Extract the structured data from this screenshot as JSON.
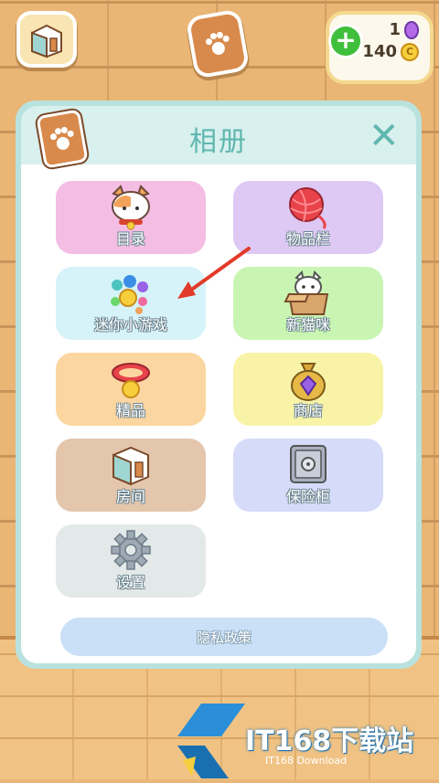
{
  "currency": {
    "gems": "1",
    "coins": "140",
    "coin_symbol": "C",
    "add_symbol": "+"
  },
  "dialog": {
    "title": "相册",
    "close_symbol": "✕",
    "tiles": [
      {
        "label": "目录",
        "color": "#f4bde3"
      },
      {
        "label": "物品栏",
        "color": "#dec8f4"
      },
      {
        "label": "迷你小游戏",
        "color": "#d6f3f9"
      },
      {
        "label": "新猫咪",
        "color": "#c9f5b3"
      },
      {
        "label": "精品",
        "color": "#fcd6a0"
      },
      {
        "label": "商店",
        "color": "#f9f3a8"
      },
      {
        "label": "房间",
        "color": "#e4c6ad"
      },
      {
        "label": "保险柜",
        "color": "#d6dbf9"
      },
      {
        "label": "设置",
        "color": "#e3e9e8"
      }
    ],
    "privacy_label": "隐私政策"
  },
  "watermark": {
    "title": "IT168下载站",
    "subtitle": "IT168 Download"
  },
  "colors": {
    "accent": "#5fb7af",
    "arrow": "#e23a2a"
  }
}
